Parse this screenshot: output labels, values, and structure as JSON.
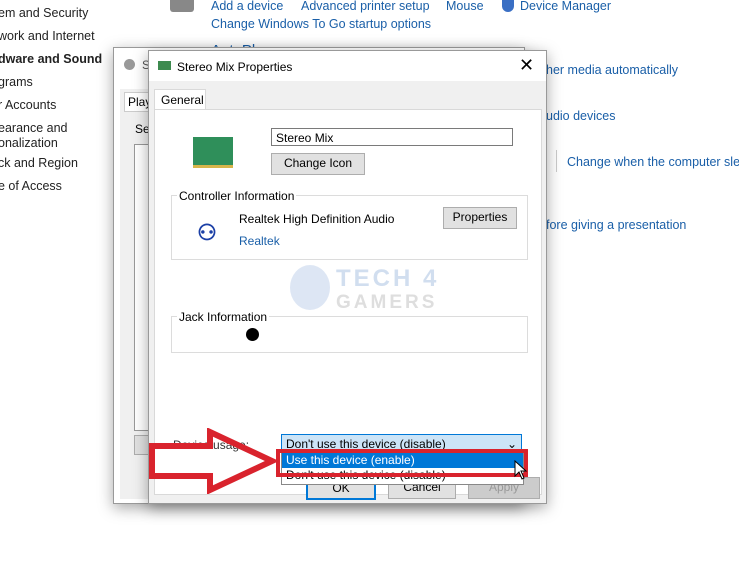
{
  "sidebar": {
    "items": [
      "em and Security",
      "work and Internet",
      "dware and Sound",
      "grams",
      "r Accounts",
      "earance and",
      "onalization",
      "ck and Region",
      "e of Access"
    ]
  },
  "top_links": {
    "add_device": "Add a device",
    "printer": "Advanced printer setup",
    "mouse": "Mouse",
    "device_manager": "Device Manager",
    "windows_to_go": "Change Windows To Go startup options",
    "autoplay": "AutoPlay",
    "media": "her media automatically",
    "audio": "udio devices",
    "sleep": "Change when the computer slee",
    "presentation": "fore giving a presentation"
  },
  "back_dialog": {
    "title": "S",
    "tab": "Playb",
    "select": "Sel"
  },
  "dialog": {
    "title": "Stereo Mix Properties",
    "close_icon": "close-icon",
    "tab": "General",
    "name_value": "Stereo Mix",
    "change_icon": "Change Icon",
    "controller": {
      "label": "Controller Information",
      "name": "Realtek High Definition Audio",
      "vendor": "Realtek",
      "properties": "Properties"
    },
    "jack": {
      "label": "Jack Information"
    },
    "usage": {
      "label": "Device usage:",
      "selected": "Don't use this device (disable)",
      "options": [
        "Use this device (enable)",
        "Don't use this device (disable)"
      ],
      "highlighted": 0
    },
    "ok": "OK",
    "cancel": "Cancel",
    "apply": "Apply"
  },
  "watermark": "TECH4GAMERS",
  "colors": {
    "annotation": "#d9232d",
    "link": "#1a5fa8",
    "highlight": "#0078d7"
  }
}
